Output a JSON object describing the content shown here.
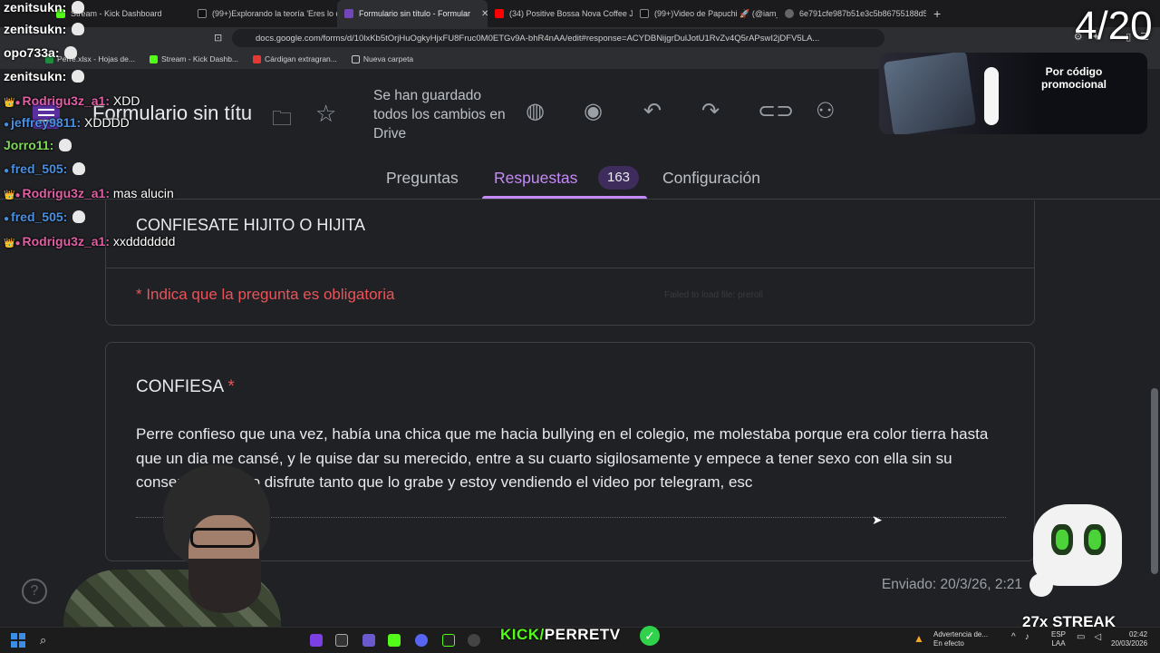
{
  "browser": {
    "tabs": [
      {
        "label": "Stream - Kick Dashboard",
        "active": false
      },
      {
        "label": "(99+)Explorando la teoría 'Eres lo qu",
        "active": false
      },
      {
        "label": "Formulario sin título - Formular",
        "active": true
      },
      {
        "label": "(34) Positive Bossa Nova Coffee J",
        "active": false
      },
      {
        "label": "(99+)Video de Papuchi 🚀 (@iam_pa",
        "active": false
      },
      {
        "label": "6e791cfe987b51e3c5b86755188d5f6",
        "active": false
      }
    ],
    "url": "docs.google.com/forms/d/10lxKb5tOrjHuOgkyHjxFU8Fruc0M0ETGv9A-bhR4nAA/edit#response=ACYDBNijgrDulJotU1RvZv4Q5rAPswI2jDFV5LA...",
    "bookmarks": [
      {
        "label": "Perre.xlsx - Hojas de..."
      },
      {
        "label": "Stream - Kick Dashb..."
      },
      {
        "label": "Cárdigan extragran..."
      },
      {
        "label": "Nueva carpeta"
      }
    ]
  },
  "form": {
    "title": "Formulario sin títu",
    "saved_status": "Se han guardado todos los cambios en Drive",
    "tabs": {
      "questions": "Preguntas",
      "responses": "Respuestas",
      "settings": "Configuración"
    },
    "response_count": "163",
    "section_heading": "CONFIESATE HIJITO O HIJITA",
    "required_note": "* Indica que la pregunta es obligatoria",
    "faint_note": "Failed to load file: preroll",
    "question": {
      "title": "CONFIESA",
      "required_mark": "*",
      "answer": "Perre confieso que una vez, había una chica que me hacia bullying en el colegio, me molestaba porque era color tierra hasta que un dia me cansé, y le quise dar su merecido, entre a su cuarto sigilosamente y empece a tener sexo con ella sin su consentimiento, lo disfrute tanto que lo grabe y estoy vendiendo el video por telegram, esc"
    },
    "sent": "Enviado: 20/3/26, 2:21"
  },
  "chat": [
    {
      "user": "zenitsukn",
      "message": "",
      "color": "#ffffff"
    },
    {
      "user": "zenitsukn",
      "message": "",
      "color": "#ffffff"
    },
    {
      "user": "opo733a",
      "message": "",
      "color": "#ffffff"
    },
    {
      "user": "zenitsukn",
      "message": "",
      "color": "#ffffff"
    },
    {
      "user": "Rodrigu3z_a1",
      "message": "XDD",
      "color": "#e05fa5"
    },
    {
      "user": "jeffrey9811",
      "message": "XDDDD",
      "color": "#4a90e2"
    },
    {
      "user": "Jorro11",
      "message": "",
      "color": "#7fd858"
    },
    {
      "user": "fred_505",
      "message": "",
      "color": "#4a90e2"
    },
    {
      "user": "Rodrigu3z_a1",
      "message": "mas alucin",
      "color": "#e05fa5"
    },
    {
      "user": "fred_505",
      "message": "",
      "color": "#4a90e2"
    },
    {
      "user": "Rodrigu3z_a1",
      "message": "xxddddddd",
      "color": "#e05fa5"
    }
  ],
  "overlay": {
    "counter": "4/20",
    "promo_text": "Por código promocional",
    "streak": "27x STREAK",
    "kick_prefix": "KICK/",
    "kick_channel": "PERRETV"
  },
  "taskbar": {
    "warning_title": "Advertencia de...",
    "warning_sub": "En efecto",
    "lang_top": "ESP",
    "lang_bottom": "LAA",
    "time": "02:42",
    "date": "20/03/2026"
  },
  "colors": {
    "accent": "#c58af9",
    "required": "#e8545a",
    "kick_green": "#53fc18"
  }
}
